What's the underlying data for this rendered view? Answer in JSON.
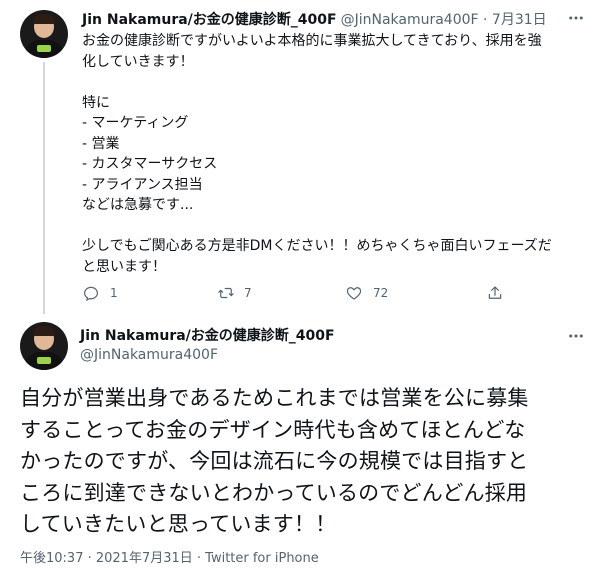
{
  "tweet1": {
    "author_name": "Jin Nakamura/お金の健康診断_400F",
    "handle_date": "@JinNakamura400F · 7月31日",
    "text": "お金の健康診断ですがいよいよ本格的に事業拡大してきており、採用を強\n化していきます！\n\n特に\n- マーケティング\n- 営業\n- カスタマーサクセス\n- アライアンス担当\nなどは急募です...\n\n少しでもご関心ある方是非DMください！！めちゃくちゃ面白いフェーズだ\nと思います！",
    "actions": {
      "reply_count": "1",
      "retweet_count": "7",
      "like_count": "72"
    }
  },
  "tweet2": {
    "author_name": "Jin Nakamura/お金の健康診断_400F",
    "handle": "@JinNakamura400F",
    "text": "自分が営業出身であるためこれまでは営業を公に募集\nすることってお金のデザイン時代も含めてほとんどな\nかったのですが、今回は流石に今の規模では目指すと\nころに到達できないとわかっているのでどんどん採用\nしていきたいと思っています！！",
    "footer": "午後10:37 · 2021年7月31日 · Twitter for iPhone"
  },
  "icons": {
    "reply": "reply-icon",
    "retweet": "retweet-icon",
    "like": "heart-icon",
    "share": "share-icon",
    "more": "more-icon"
  }
}
